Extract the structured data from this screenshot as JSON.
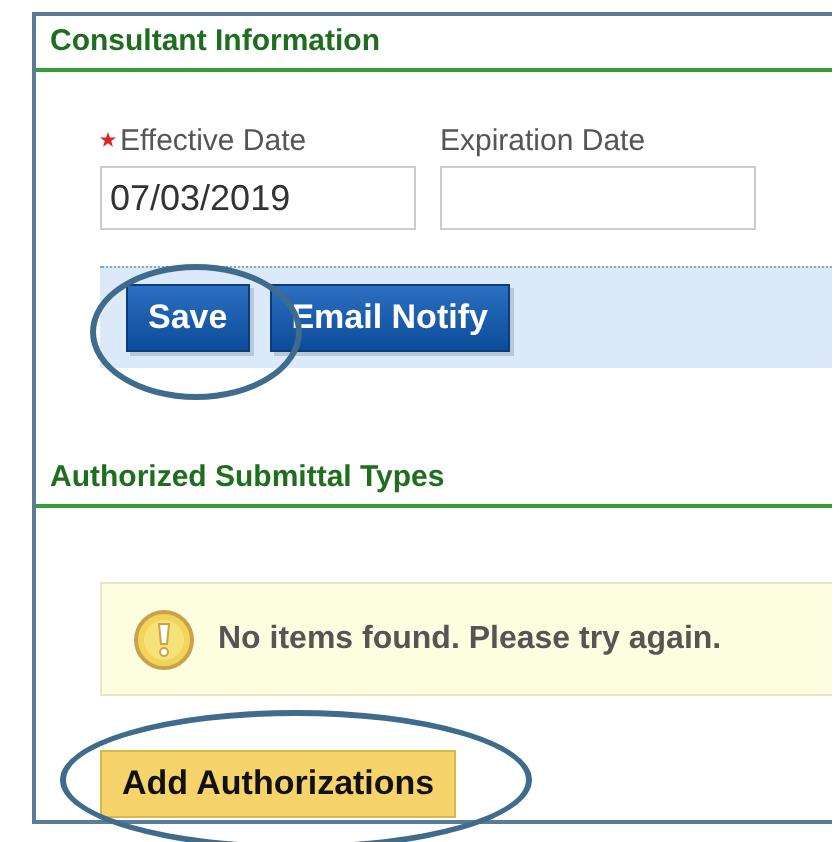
{
  "sections": [
    {
      "title": "Consultant Information",
      "fields": [
        {
          "label": "Effective Date",
          "required": true,
          "value": "07/03/2019"
        },
        {
          "label": "Expiration Date",
          "required": false
        }
      ],
      "buttons": [
        {
          "label": "Save",
          "kind": "primary"
        },
        {
          "label": "Email Notify",
          "kind": "primary"
        }
      ]
    },
    {
      "title": "Authorized Submittal Types",
      "message": {
        "kind": "warning",
        "text": "No items found. Please try again."
      },
      "buttons": [
        {
          "label": "Add Authorizations",
          "kind": "secondary"
        }
      ]
    }
  ]
}
